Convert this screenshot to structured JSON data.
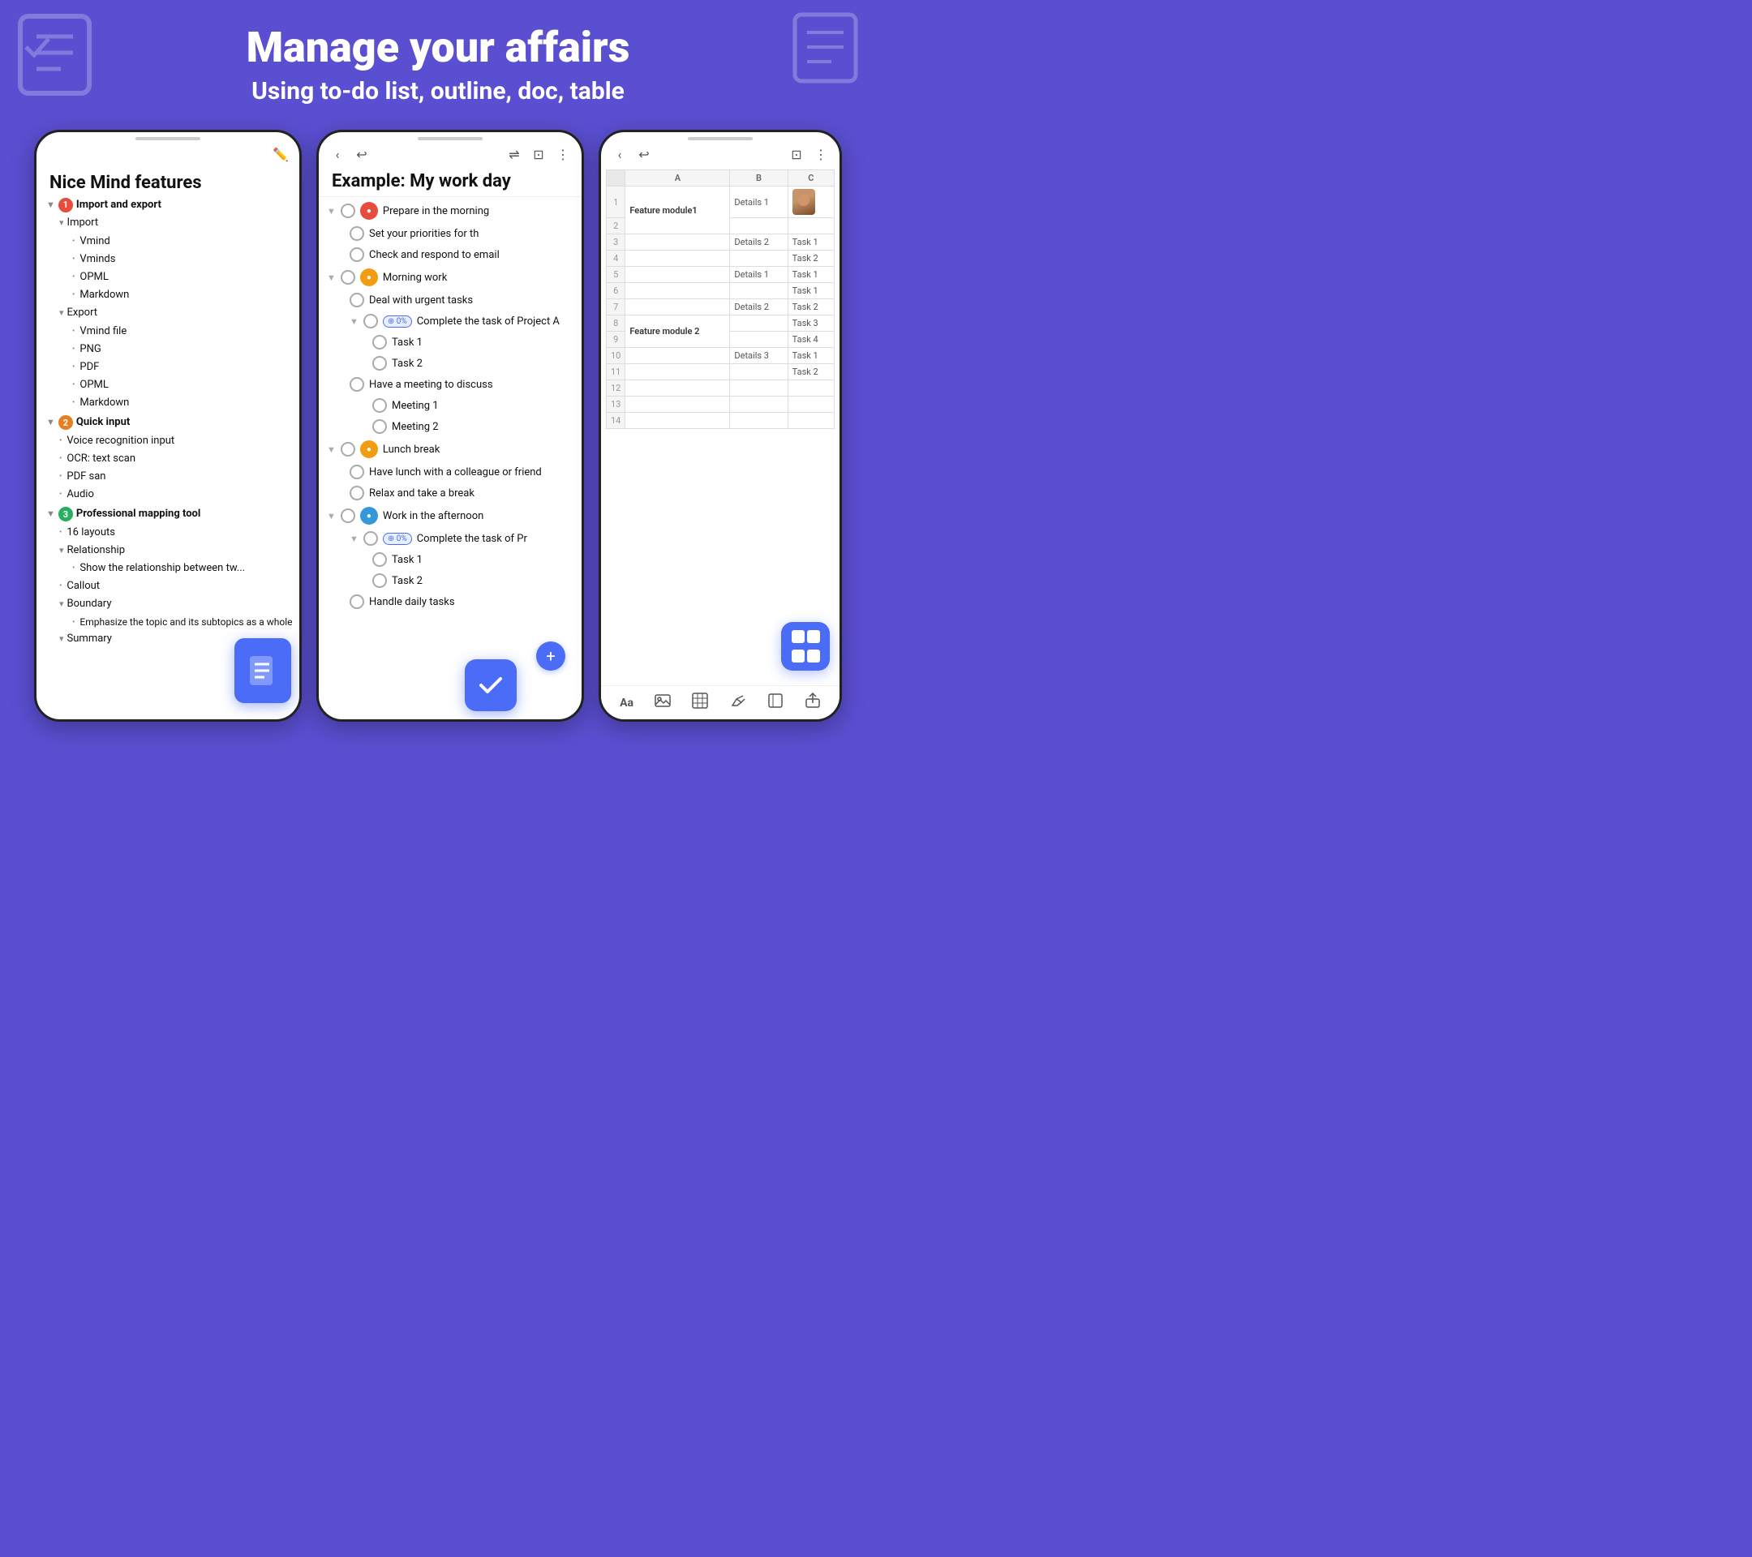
{
  "header": {
    "title": "Manage your affairs",
    "subtitle": "Using to-do list, outline, doc, table"
  },
  "phone_left": {
    "outline_title": "Nice Mind features",
    "items": [
      {
        "indent": 0,
        "type": "section",
        "badge": "1",
        "badge_color": "red",
        "label": "Import and export"
      },
      {
        "indent": 1,
        "type": "section",
        "label": "Import"
      },
      {
        "indent": 2,
        "type": "bullet",
        "label": "Vmind"
      },
      {
        "indent": 2,
        "type": "bullet",
        "label": "Vminds"
      },
      {
        "indent": 2,
        "type": "bullet",
        "label": "OPML"
      },
      {
        "indent": 2,
        "type": "bullet",
        "label": "Markdown"
      },
      {
        "indent": 1,
        "type": "section",
        "label": "Export"
      },
      {
        "indent": 2,
        "type": "bullet",
        "label": "Vmind file"
      },
      {
        "indent": 2,
        "type": "bullet",
        "label": "PNG"
      },
      {
        "indent": 2,
        "type": "bullet",
        "label": "PDF"
      },
      {
        "indent": 2,
        "type": "bullet",
        "label": "OPML"
      },
      {
        "indent": 2,
        "type": "bullet",
        "label": "Markdown"
      },
      {
        "indent": 0,
        "type": "section",
        "badge": "2",
        "badge_color": "orange",
        "label": "Quick input"
      },
      {
        "indent": 1,
        "type": "bullet",
        "label": "Voice recognition input"
      },
      {
        "indent": 1,
        "type": "bullet",
        "label": "OCR: text scan"
      },
      {
        "indent": 1,
        "type": "bullet",
        "label": "PDF san"
      },
      {
        "indent": 1,
        "type": "bullet",
        "label": "Audio"
      },
      {
        "indent": 0,
        "type": "section",
        "badge": "3",
        "badge_color": "green",
        "label": "Professional mapping tool"
      },
      {
        "indent": 1,
        "type": "bullet",
        "label": "16 layouts"
      },
      {
        "indent": 1,
        "type": "section",
        "label": "Relationship"
      },
      {
        "indent": 2,
        "type": "bullet",
        "label": "Show the relationship between two..."
      },
      {
        "indent": 1,
        "type": "bullet",
        "label": "Callout"
      },
      {
        "indent": 1,
        "type": "section",
        "label": "Boundary"
      },
      {
        "indent": 2,
        "type": "bullet",
        "label": "Emphasize the topic and its subtopics as a whole"
      },
      {
        "indent": 1,
        "type": "section",
        "label": "Summary"
      }
    ]
  },
  "phone_center": {
    "toolbar_back": "‹",
    "toolbar_undo": "↩",
    "title": "Example: My work day",
    "todos": [
      {
        "indent": 0,
        "collapse": true,
        "checkbox": true,
        "priority": "red",
        "text": "Prepare in the morning"
      },
      {
        "indent": 1,
        "checkbox": true,
        "text": "Set your priorities for th"
      },
      {
        "indent": 1,
        "checkbox": true,
        "text": "Check and respond to email"
      },
      {
        "indent": 0,
        "collapse": true,
        "checkbox": true,
        "priority": "yellow",
        "text": "Morning work"
      },
      {
        "indent": 1,
        "checkbox": true,
        "text": "Deal with urgent tasks"
      },
      {
        "indent": 1,
        "collapse": true,
        "checkbox": true,
        "progress": "0%",
        "text": "Complete the task of Project A"
      },
      {
        "indent": 2,
        "checkbox": true,
        "text": "Task 1"
      },
      {
        "indent": 2,
        "checkbox": true,
        "text": "Task 2"
      },
      {
        "indent": 1,
        "checkbox": true,
        "text": "Have a meeting to discuss"
      },
      {
        "indent": 2,
        "checkbox": true,
        "text": "Meeting 1"
      },
      {
        "indent": 2,
        "checkbox": true,
        "text": "Meeting 2"
      },
      {
        "indent": 0,
        "collapse": true,
        "checkbox": true,
        "priority": "yellow",
        "text": "Lunch break"
      },
      {
        "indent": 1,
        "checkbox": true,
        "text": "Have lunch with a colleague or friend"
      },
      {
        "indent": 1,
        "checkbox": true,
        "text": "Relax and take a break"
      },
      {
        "indent": 0,
        "collapse": true,
        "checkbox": true,
        "priority": "blue",
        "text": "Work in the afternoon"
      },
      {
        "indent": 1,
        "collapse": true,
        "checkbox": true,
        "progress": "0%",
        "text": "Complete the task of Pr"
      },
      {
        "indent": 2,
        "checkbox": true,
        "text": "Task 1"
      },
      {
        "indent": 2,
        "checkbox": true,
        "text": "Task 2"
      },
      {
        "indent": 1,
        "checkbox": true,
        "text": "Handle daily tasks"
      }
    ]
  },
  "phone_right": {
    "col_headers": [
      "",
      "A",
      "B",
      "C"
    ],
    "rows": [
      {
        "num": "1",
        "a": "",
        "b": "Details 1",
        "c": "avatar"
      },
      {
        "num": "2",
        "a": "Feature module1",
        "b": "",
        "c": ""
      },
      {
        "num": "3",
        "a": "",
        "b": "Details 2",
        "c": "Task 1"
      },
      {
        "num": "4",
        "a": "",
        "b": "",
        "c": "Task 2"
      },
      {
        "num": "5",
        "a": "",
        "b": "Details 1",
        "c": "Task 1"
      },
      {
        "num": "6",
        "a": "",
        "b": "",
        "c": "Task 1"
      },
      {
        "num": "7",
        "a": "",
        "b": "Details 2",
        "c": "Task 2"
      },
      {
        "num": "8",
        "a": "Feature module 2",
        "b": "",
        "c": "Task 3"
      },
      {
        "num": "9",
        "a": "",
        "b": "",
        "c": "Task 4"
      },
      {
        "num": "10",
        "a": "",
        "b": "Details 3",
        "c": "Task 1"
      },
      {
        "num": "11",
        "a": "",
        "b": "",
        "c": "Task 2"
      },
      {
        "num": "12",
        "a": "",
        "b": "",
        "c": ""
      },
      {
        "num": "13",
        "a": "",
        "b": "",
        "c": ""
      },
      {
        "num": "14",
        "a": "",
        "b": "",
        "c": ""
      }
    ],
    "bottom_icons": [
      "Aa",
      "🖼",
      "⊞",
      "◇",
      "⬚",
      "⊡"
    ]
  }
}
